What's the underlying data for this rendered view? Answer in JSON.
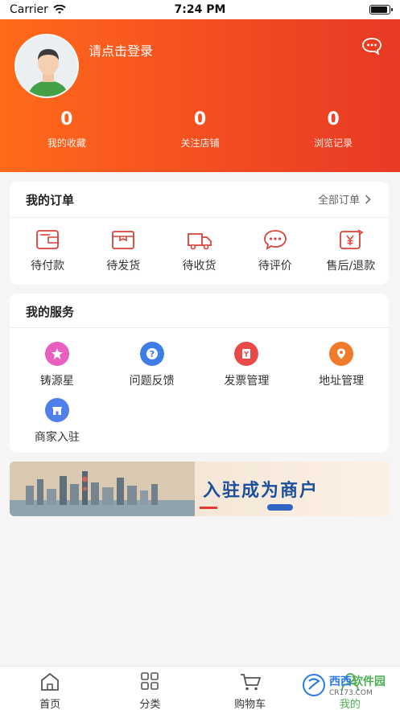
{
  "status_bar": {
    "carrier": "Carrier",
    "time": "7:24 PM",
    "battery_level": 0.9
  },
  "header": {
    "login_text": "请点击登录",
    "stats": [
      {
        "value": "0",
        "label": "我的收藏"
      },
      {
        "value": "0",
        "label": "关注店铺"
      },
      {
        "value": "0",
        "label": "浏览记录"
      }
    ]
  },
  "orders": {
    "title": "我的订单",
    "all_label": "全部订单",
    "items": [
      {
        "label": "待付款",
        "icon": "wallet-icon"
      },
      {
        "label": "待发货",
        "icon": "box-icon"
      },
      {
        "label": "待收货",
        "icon": "truck-icon"
      },
      {
        "label": "待评价",
        "icon": "chat-bubble-icon"
      },
      {
        "label": "售后/退款",
        "icon": "refund-icon"
      }
    ]
  },
  "services": {
    "title": "我的服务",
    "items": [
      {
        "label": "铸源星",
        "icon": "star-icon",
        "color": "#e85fc0"
      },
      {
        "label": "问题反馈",
        "icon": "question-icon",
        "color": "#3d7de6"
      },
      {
        "label": "发票管理",
        "icon": "invoice-icon",
        "color": "#e84a4a"
      },
      {
        "label": "地址管理",
        "icon": "location-icon",
        "color": "#f07b2a"
      },
      {
        "label": "商家入驻",
        "icon": "shop-icon",
        "color": "#4f7fe8"
      }
    ]
  },
  "banner": {
    "text": "入驻成为商户"
  },
  "tabbar": {
    "tabs": [
      {
        "label": "首页",
        "icon": "home-icon"
      },
      {
        "label": "分类",
        "icon": "grid-icon"
      },
      {
        "label": "购物车",
        "icon": "cart-icon"
      },
      {
        "label": "我的",
        "icon": "user-icon"
      }
    ]
  },
  "watermark": {
    "text1": "西西",
    "text2": "软件园",
    "sub": "CR173.COM"
  },
  "colors": {
    "accent": "#f24a22",
    "gradient_start": "#ff6a1a",
    "gradient_end": "#e83a25"
  }
}
